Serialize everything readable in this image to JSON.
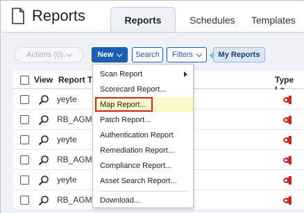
{
  "header": {
    "title": "Reports",
    "tabs": [
      {
        "label": "Reports",
        "active": true
      },
      {
        "label": "Schedules",
        "active": false
      },
      {
        "label": "Templates",
        "active": false
      }
    ]
  },
  "toolbar": {
    "actions_label": "Actions (0)",
    "new_label": "New",
    "search_label": "Search",
    "filters_label": "Filters",
    "my_reports_label": "My Reports"
  },
  "table": {
    "columns": [
      "View",
      "Report T",
      "Type La"
    ],
    "rows": [
      {
        "title": "yeyte"
      },
      {
        "title": "RB_AGM"
      },
      {
        "title": "yeyte"
      },
      {
        "title": "RB_AGM"
      },
      {
        "title": "yeyte"
      },
      {
        "title": "RB_AGM"
      }
    ]
  },
  "menu": {
    "items": [
      {
        "label": "Scan Report",
        "has_submenu": true
      },
      {
        "label": "Scorecard Report..."
      },
      {
        "label": "Map Report...",
        "highlighted": true
      },
      {
        "label": "Patch Report..."
      },
      {
        "label": "Authentication Report"
      },
      {
        "label": "Remediation Report..."
      },
      {
        "label": "Compliance Report..."
      },
      {
        "label": "Asset Search Report..."
      },
      {
        "label": "Download..."
      }
    ]
  },
  "colors": {
    "primary": "#1a5fb4",
    "highlight": "#fbf7c9",
    "callout": "#c62828",
    "type_icon": "#c62828"
  }
}
